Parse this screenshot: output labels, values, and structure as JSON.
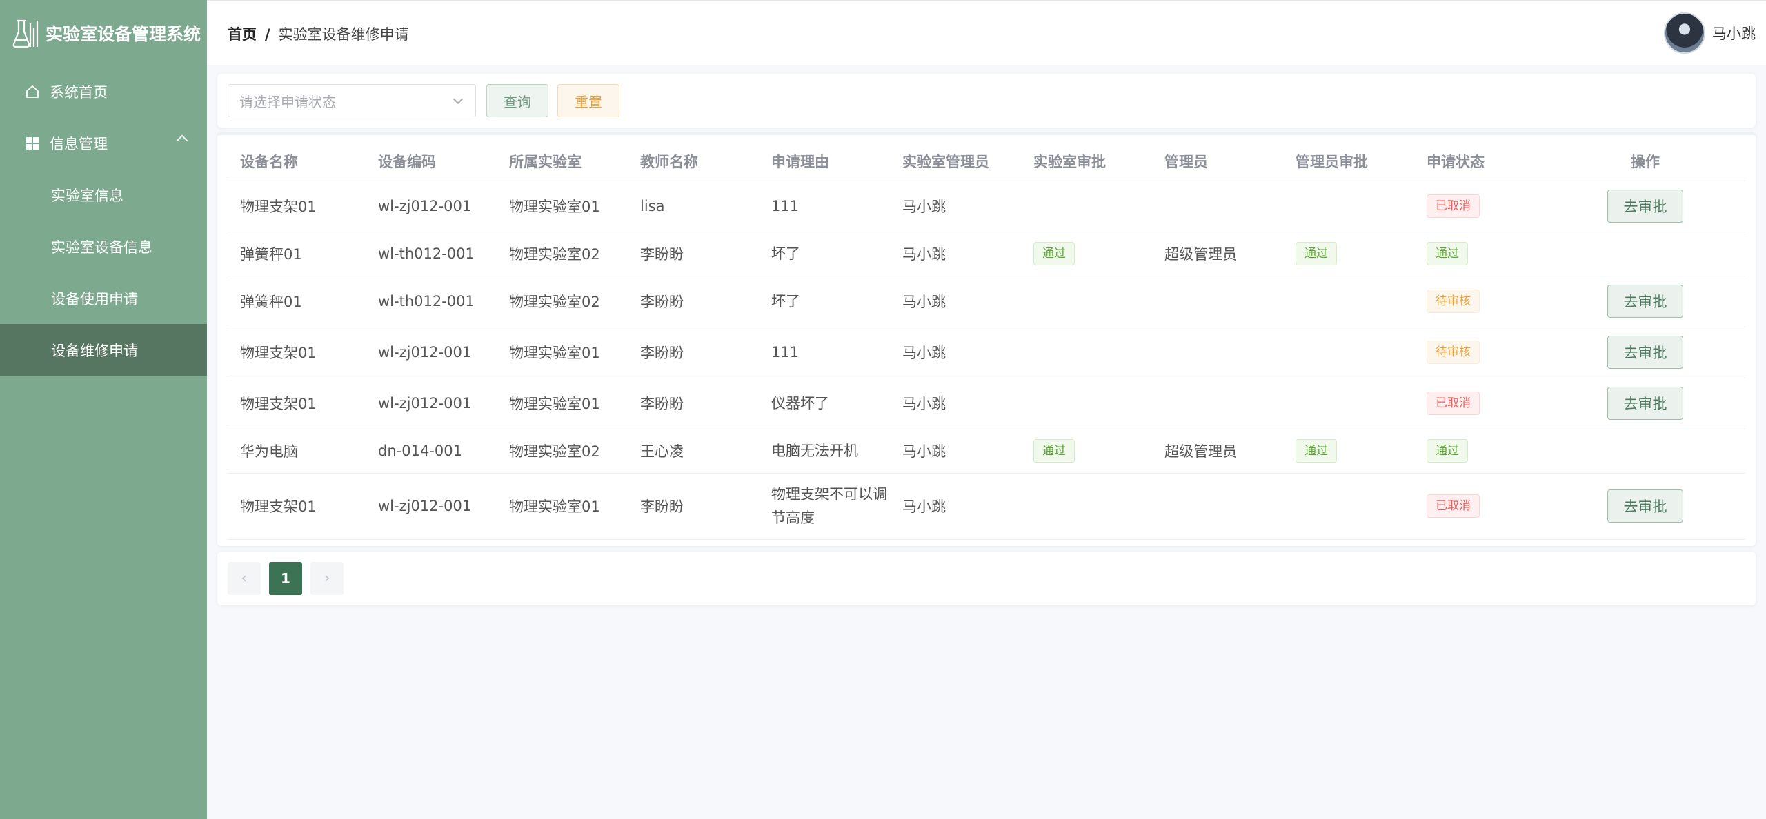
{
  "app": {
    "title": "实验室设备管理系统"
  },
  "sidebar": {
    "items": [
      {
        "label": "系统首页"
      },
      {
        "label": "信息管理"
      }
    ],
    "sub_items": [
      {
        "label": "实验室信息"
      },
      {
        "label": "实验室设备信息"
      },
      {
        "label": "设备使用申请"
      },
      {
        "label": "设备维修申请"
      }
    ]
  },
  "header": {
    "breadcrumb_home": "首页",
    "breadcrumb_sep": "/",
    "breadcrumb_current": "实验室设备维修申请",
    "user_name": "马小跳"
  },
  "filter": {
    "status_placeholder": "请选择申请状态",
    "query_label": "查询",
    "reset_label": "重置"
  },
  "table": {
    "columns": [
      "设备名称",
      "设备编码",
      "所属实验室",
      "教师名称",
      "申请理由",
      "实验室管理员",
      "实验室审批",
      "管理员",
      "管理员审批",
      "申请状态",
      "操作"
    ],
    "action_label": "去审批",
    "rows": [
      {
        "name": "物理支架01",
        "code": "wl-zj012-001",
        "lab": "物理实验室01",
        "teacher": "lisa",
        "reason": "111",
        "lab_admin": "马小跳",
        "lab_approval": "",
        "admin": "",
        "admin_approval": "",
        "status": "已取消",
        "has_action": true
      },
      {
        "name": "弹簧秤01",
        "code": "wl-th012-001",
        "lab": "物理实验室02",
        "teacher": "李盼盼",
        "reason": "坏了",
        "lab_admin": "马小跳",
        "lab_approval": "通过",
        "admin": "超级管理员",
        "admin_approval": "通过",
        "status": "通过",
        "has_action": false
      },
      {
        "name": "弹簧秤01",
        "code": "wl-th012-001",
        "lab": "物理实验室02",
        "teacher": "李盼盼",
        "reason": "坏了",
        "lab_admin": "马小跳",
        "lab_approval": "",
        "admin": "",
        "admin_approval": "",
        "status": "待审核",
        "has_action": true
      },
      {
        "name": "物理支架01",
        "code": "wl-zj012-001",
        "lab": "物理实验室01",
        "teacher": "李盼盼",
        "reason": "111",
        "lab_admin": "马小跳",
        "lab_approval": "",
        "admin": "",
        "admin_approval": "",
        "status": "待审核",
        "has_action": true
      },
      {
        "name": "物理支架01",
        "code": "wl-zj012-001",
        "lab": "物理实验室01",
        "teacher": "李盼盼",
        "reason": "仪器坏了",
        "lab_admin": "马小跳",
        "lab_approval": "",
        "admin": "",
        "admin_approval": "",
        "status": "已取消",
        "has_action": true
      },
      {
        "name": "华为电脑",
        "code": "dn-014-001",
        "lab": "物理实验室02",
        "teacher": "王心凌",
        "reason": "电脑无法开机",
        "lab_admin": "马小跳",
        "lab_approval": "通过",
        "admin": "超级管理员",
        "admin_approval": "通过",
        "status": "通过",
        "has_action": false
      },
      {
        "name": "物理支架01",
        "code": "wl-zj012-001",
        "lab": "物理实验室01",
        "teacher": "李盼盼",
        "reason": "物理支架不可以调节高度",
        "lab_admin": "马小跳",
        "lab_approval": "",
        "admin": "",
        "admin_approval": "",
        "status": "已取消",
        "has_action": true
      }
    ]
  },
  "pagination": {
    "current_page": "1",
    "prev_icon": "chevron-left-icon",
    "next_icon": "chevron-right-icon"
  },
  "colors": {
    "sidebar_bg": "#7da98f",
    "sidebar_active": "#577661",
    "primary": "#3d7355",
    "success": "#5aa832",
    "danger": "#e65c5c",
    "warning": "#e6a23c"
  }
}
